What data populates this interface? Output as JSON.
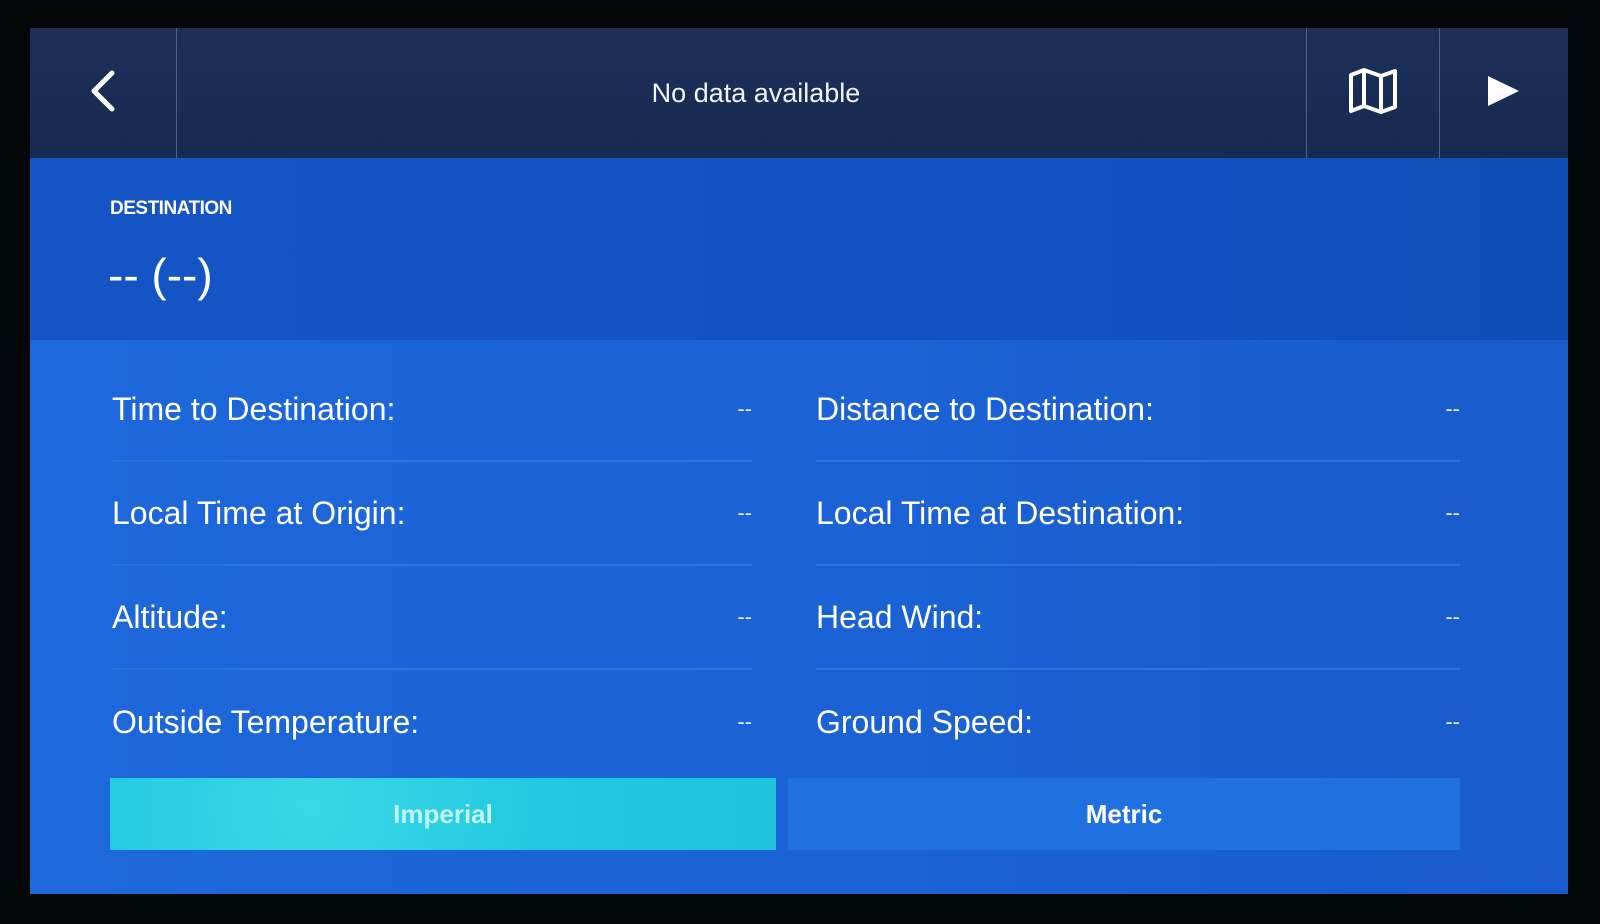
{
  "header": {
    "title": "No data available",
    "back_icon": "chevron-left-icon",
    "map_icon": "map-icon",
    "play_icon": "play-icon"
  },
  "destination": {
    "label": "DESTINATION",
    "value": "-- (--)"
  },
  "info": {
    "left": [
      {
        "label": "Time to Destination:",
        "value": "--"
      },
      {
        "label": "Local Time at Origin:",
        "value": "--"
      },
      {
        "label": "Altitude:",
        "value": "--"
      },
      {
        "label": "Outside Temperature:",
        "value": "--"
      }
    ],
    "right": [
      {
        "label": "Distance to Destination:",
        "value": "--"
      },
      {
        "label": "Local Time at Destination:",
        "value": "--"
      },
      {
        "label": "Head Wind:",
        "value": "--"
      },
      {
        "label": "Ground Speed:",
        "value": "--"
      }
    ]
  },
  "units": {
    "imperial_label": "Imperial",
    "metric_label": "Metric",
    "selected": "Imperial"
  },
  "colors": {
    "accent_cyan": "#22c8e0",
    "panel_blue": "#1b62d6",
    "topbar": "#1c2f5a"
  }
}
